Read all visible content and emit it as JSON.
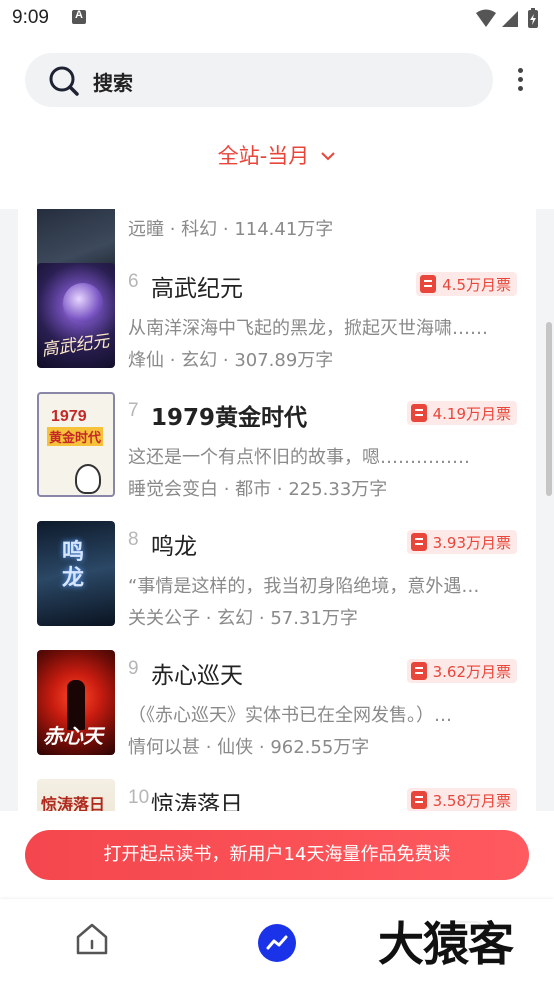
{
  "status_bar": {
    "time": "9:09"
  },
  "header": {
    "search_placeholder": "搜索"
  },
  "filter": {
    "label": "全站-当月"
  },
  "partial_item": {
    "meta": "远瞳 · 科幻 · 114.41万字"
  },
  "items": [
    {
      "rank": "6",
      "title": "高武纪元",
      "ticket": "4.5万月票",
      "desc": "从南洋深海中飞起的黑龙，掀起灭世海啸……",
      "meta": "烽仙 · 玄幻 · 307.89万字",
      "cover_text": "高武纪元"
    },
    {
      "rank": "7",
      "title": "1979黄金时代",
      "ticket": "4.19万月票",
      "desc": "这还是一个有点怀旧的故事，嗯……………",
      "meta": "睡觉会变白 · 都市 · 225.33万字",
      "cover_text": "1979黄金时代"
    },
    {
      "rank": "8",
      "title": "鸣龙",
      "ticket": "3.93万月票",
      "desc": "“事情是这样的，我当初身陷绝境，意外遇…",
      "meta": "关关公子 · 玄幻 · 57.31万字",
      "cover_text": "鸣龙"
    },
    {
      "rank": "9",
      "title": "赤心巡天",
      "ticket": "3.62万月票",
      "desc": "（《赤心巡天》实体书已在全网发售。）…",
      "meta": "情何以甚 · 仙侠 · 962.55万字",
      "cover_text": "赤心巡天"
    },
    {
      "rank": "10",
      "title": "惊涛落日",
      "ticket": "3.58万月票",
      "desc": "",
      "meta": "",
      "cover_text": "惊涛落日"
    }
  ],
  "cta": {
    "label": "打开起点读书，新用户14天海量作品免费读"
  },
  "watermark": "大猿客",
  "colors": {
    "accent": "#e8463a",
    "nav_active": "#1a32e8"
  }
}
